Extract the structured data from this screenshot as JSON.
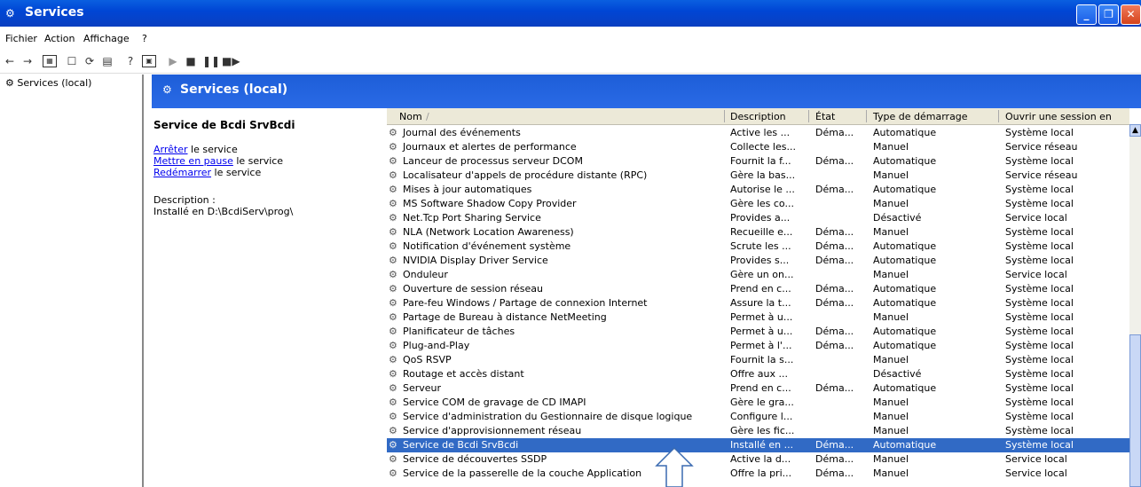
{
  "window": {
    "title": "Services",
    "minimize": "_",
    "maximize": "❐",
    "close": "✕"
  },
  "menu": [
    "Fichier",
    "Action",
    "Affichage",
    "?"
  ],
  "tree": {
    "root": "Services (local)"
  },
  "header": {
    "title": "Services (local)"
  },
  "details": {
    "service_title": "Service de Bcdi SrvBcdi",
    "stop_link": "Arrêter",
    "stop_rest": " le service",
    "pause_link": "Mettre en pause",
    "pause_rest": " le service",
    "restart_link": "Redémarrer",
    "restart_rest": " le service",
    "desc_label": "Description :",
    "desc_text": "Installé en D:\\BcdiServ\\prog\\"
  },
  "columns": [
    "Nom",
    "Description",
    "État",
    "Type de démarrage",
    "Ouvrir une session en"
  ],
  "sort_indicator": "/",
  "services": [
    [
      "Journal des événements",
      "Active les ...",
      "Déma...",
      "Automatique",
      "Système local"
    ],
    [
      "Journaux et alertes de performance",
      "Collecte les...",
      "",
      "Manuel",
      "Service réseau"
    ],
    [
      "Lanceur de processus serveur DCOM",
      "Fournit la f...",
      "Déma...",
      "Automatique",
      "Système local"
    ],
    [
      "Localisateur d'appels de procédure distante (RPC)",
      "Gère la bas...",
      "",
      "Manuel",
      "Service réseau"
    ],
    [
      "Mises à jour automatiques",
      "Autorise le ...",
      "Déma...",
      "Automatique",
      "Système local"
    ],
    [
      "MS Software Shadow Copy Provider",
      "Gère les co...",
      "",
      "Manuel",
      "Système local"
    ],
    [
      "Net.Tcp Port Sharing Service",
      "Provides a...",
      "",
      "Désactivé",
      "Service local"
    ],
    [
      "NLA (Network Location Awareness)",
      "Recueille e...",
      "Déma...",
      "Manuel",
      "Système local"
    ],
    [
      "Notification d'événement système",
      "Scrute les ...",
      "Déma...",
      "Automatique",
      "Système local"
    ],
    [
      "NVIDIA Display Driver Service",
      "Provides s...",
      "Déma...",
      "Automatique",
      "Système local"
    ],
    [
      "Onduleur",
      "Gère un on...",
      "",
      "Manuel",
      "Service local"
    ],
    [
      "Ouverture de session réseau",
      "Prend en c...",
      "Déma...",
      "Automatique",
      "Système local"
    ],
    [
      "Pare-feu Windows / Partage de connexion Internet",
      "Assure la t...",
      "Déma...",
      "Automatique",
      "Système local"
    ],
    [
      "Partage de Bureau à distance NetMeeting",
      "Permet à u...",
      "",
      "Manuel",
      "Système local"
    ],
    [
      "Planificateur de tâches",
      "Permet à u...",
      "Déma...",
      "Automatique",
      "Système local"
    ],
    [
      "Plug-and-Play",
      "Permet à l'...",
      "Déma...",
      "Automatique",
      "Système local"
    ],
    [
      "QoS RSVP",
      "Fournit la s...",
      "",
      "Manuel",
      "Système local"
    ],
    [
      "Routage et accès distant",
      "Offre aux ...",
      "",
      "Désactivé",
      "Système local"
    ],
    [
      "Serveur",
      "Prend en c...",
      "Déma...",
      "Automatique",
      "Système local"
    ],
    [
      "Service COM de gravage de CD IMAPI",
      "Gère le gra...",
      "",
      "Manuel",
      "Système local"
    ],
    [
      "Service d'administration du Gestionnaire de disque logique",
      "Configure l...",
      "",
      "Manuel",
      "Système local"
    ],
    [
      "Service d'approvisionnement réseau",
      "Gère les fic...",
      "",
      "Manuel",
      "Système local"
    ],
    [
      "Service de Bcdi SrvBcdi",
      "Installé en ...",
      "Déma...",
      "Automatique",
      "Système local"
    ],
    [
      "Service de découvertes SSDP",
      "Active la d...",
      "Déma...",
      "Manuel",
      "Service local"
    ],
    [
      "Service de la passerelle de la couche Application",
      "Offre la pri...",
      "Déma...",
      "Manuel",
      "Service local"
    ]
  ],
  "selected_index": 22,
  "colors": {
    "title_blue": "#0046d5",
    "selection": "#316ac5",
    "header_blue": "#1d5ed8"
  }
}
